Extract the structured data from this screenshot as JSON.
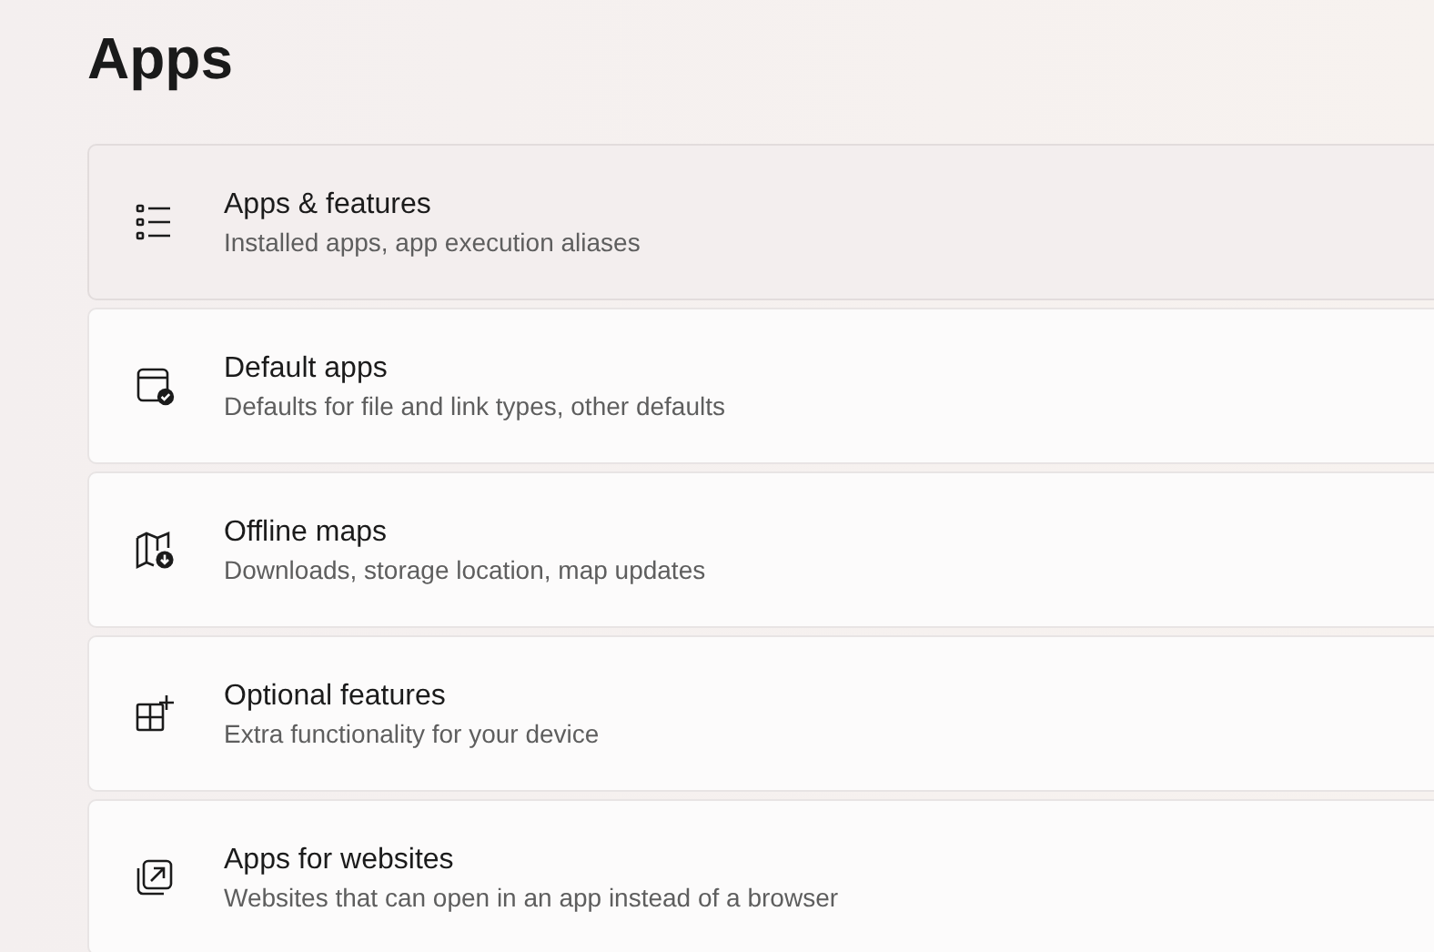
{
  "page_title": "Apps",
  "items": [
    {
      "title": "Apps & features",
      "subtitle": "Installed apps, app execution aliases",
      "highlighted": true
    },
    {
      "title": "Default apps",
      "subtitle": "Defaults for file and link types, other defaults",
      "highlighted": false
    },
    {
      "title": "Offline maps",
      "subtitle": "Downloads, storage location, map updates",
      "highlighted": false
    },
    {
      "title": "Optional features",
      "subtitle": "Extra functionality for your device",
      "highlighted": false
    },
    {
      "title": "Apps for websites",
      "subtitle": "Websites that can open in an app instead of a browser",
      "highlighted": false
    }
  ]
}
